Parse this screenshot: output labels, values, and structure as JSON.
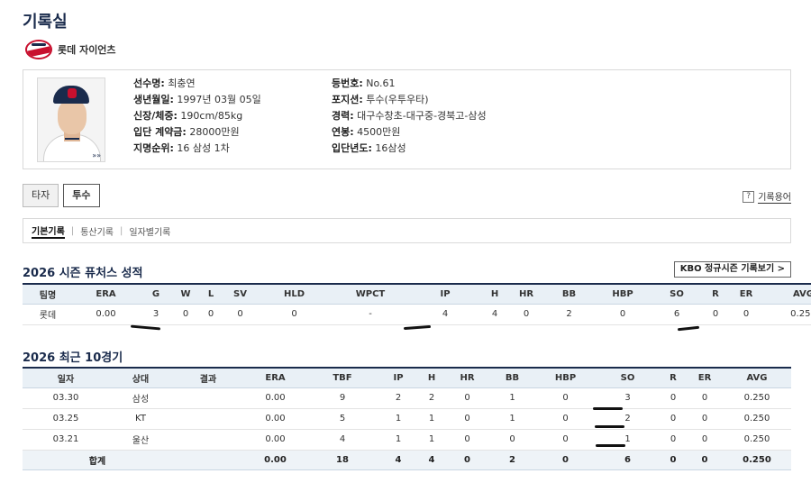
{
  "page": {
    "title": "기록실"
  },
  "team": {
    "name": "롯데 자이언츠"
  },
  "player": {
    "left": [
      {
        "key": "선수명:",
        "value": "최충연"
      },
      {
        "key": "생년월일:",
        "value": "1997년 03월 05일"
      },
      {
        "key": "신장/체중:",
        "value": "190cm/85kg"
      },
      {
        "key": "입단 계약금:",
        "value": "28000만원"
      },
      {
        "key": "지명순위:",
        "value": "16 삼성 1차"
      }
    ],
    "right": [
      {
        "key": "등번호:",
        "value": "No.61"
      },
      {
        "key": "포지션:",
        "value": "투수(우투우타)"
      },
      {
        "key": "경력:",
        "value": "대구수창초-대구중-경북고-삼성"
      },
      {
        "key": "연봉:",
        "value": "4500만원"
      },
      {
        "key": "입단년도:",
        "value": "16삼성"
      }
    ]
  },
  "tabs": {
    "batter": "타자",
    "pitcher": "투수"
  },
  "glossary": {
    "icon": "?",
    "label": "기록용어"
  },
  "subnav": {
    "items": [
      "기본기록",
      "통산기록",
      "일자별기록"
    ],
    "separator": "|"
  },
  "season": {
    "title": "2026 시즌 퓨처스 성적",
    "kbo_button": "KBO 정규시즌 기록보기 >",
    "headers": [
      "팀명",
      "ERA",
      "G",
      "W",
      "L",
      "SV",
      "HLD",
      "WPCT",
      "IP",
      "H",
      "HR",
      "BB",
      "HBP",
      "SO",
      "R",
      "ER",
      "AVG"
    ],
    "row": [
      "롯데",
      "0.00",
      "3",
      "0",
      "0",
      "0",
      "0",
      "-",
      "4",
      "4",
      "0",
      "2",
      "0",
      "6",
      "0",
      "0",
      "0.250"
    ]
  },
  "recent": {
    "title": "2026 최근 10경기",
    "headers": [
      "일자",
      "상대",
      "결과",
      "ERA",
      "TBF",
      "IP",
      "H",
      "HR",
      "BB",
      "HBP",
      "SO",
      "R",
      "ER",
      "AVG"
    ],
    "rows": [
      [
        "03.30",
        "삼성",
        "",
        "0.00",
        "9",
        "2",
        "2",
        "0",
        "1",
        "0",
        "3",
        "0",
        "0",
        "0.250"
      ],
      [
        "03.25",
        "KT",
        "",
        "0.00",
        "5",
        "1",
        "1",
        "0",
        "1",
        "0",
        "2",
        "0",
        "0",
        "0.250"
      ],
      [
        "03.21",
        "울산",
        "",
        "0.00",
        "4",
        "1",
        "1",
        "0",
        "0",
        "0",
        "1",
        "0",
        "0",
        "0.250"
      ]
    ],
    "total": [
      "합계",
      "",
      "0.00",
      "18",
      "4",
      "4",
      "0",
      "2",
      "0",
      "6",
      "0",
      "0",
      "0.250"
    ]
  }
}
